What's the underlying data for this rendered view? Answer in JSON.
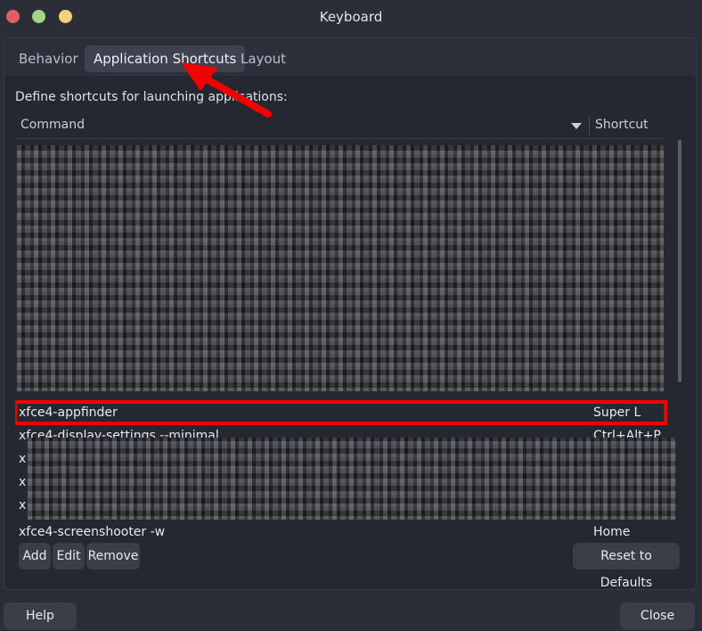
{
  "window": {
    "title": "Keyboard"
  },
  "tabs": [
    {
      "label": "Behavior",
      "selected": false
    },
    {
      "label": "Application Shortcuts",
      "selected": true
    },
    {
      "label": "Layout",
      "selected": false
    }
  ],
  "description": "Define shortcuts for launching applications:",
  "table": {
    "columns": [
      "Command",
      "Shortcut"
    ],
    "rows": [
      {
        "command": "",
        "shortcut": "",
        "obscured": true
      },
      {
        "command": "",
        "shortcut": "",
        "obscured": true
      },
      {
        "command": "xfce4-appfinder",
        "shortcut": "Super L",
        "highlighted": true
      },
      {
        "command": "xfce4-display-settings --minimal",
        "shortcut": "Ctrl+Alt+P",
        "partially_visible": true
      },
      {
        "command": "x",
        "shortcut": "",
        "obscured": true
      },
      {
        "command": "x",
        "shortcut": "",
        "obscured": true
      },
      {
        "command": "x",
        "shortcut": "",
        "obscured": true
      },
      {
        "command": "xfce4-screenshooter -w",
        "shortcut": "Home",
        "partially_visible": true
      }
    ]
  },
  "buttons": {
    "add": "Add",
    "edit": "Edit",
    "remove": "Remove",
    "reset": "Reset to Defaults",
    "help": "Help",
    "close": "Close"
  },
  "colors": {
    "background": "#2b2e37",
    "highlight_box": "#f00000",
    "annotation_arrow": "#f00000"
  }
}
